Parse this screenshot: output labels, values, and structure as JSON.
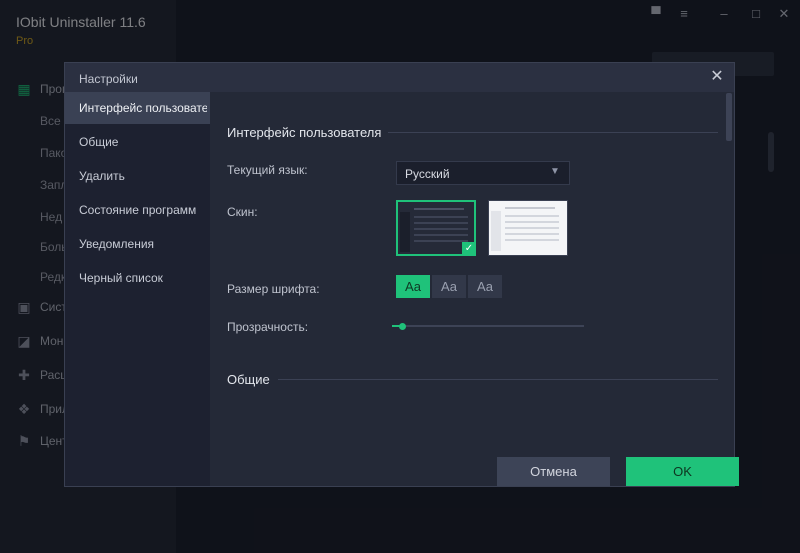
{
  "app": {
    "title": "IObit Uninstaller 11.6",
    "edition": "Pro",
    "nav": [
      {
        "label": "Прог",
        "icon": "grid-icon"
      },
      {
        "label": "Сист",
        "icon": "windows-icon"
      },
      {
        "label": "Мон",
        "icon": "chart-icon"
      },
      {
        "label": "Расш",
        "icon": "puzzle-icon"
      },
      {
        "label": "Прил",
        "icon": "windows-store-icon"
      },
      {
        "label": "Цент",
        "icon": "flag-icon"
      }
    ],
    "subnav": [
      "Все п",
      "Пако",
      "Запл",
      "Нед",
      "Боль",
      "Редк"
    ]
  },
  "dialog": {
    "title": "Настройки",
    "close_icon": "close-icon",
    "nav": [
      {
        "label": "Интерфейс пользовател",
        "active": true
      },
      {
        "label": "Общие",
        "active": false
      },
      {
        "label": "Удалить",
        "active": false
      },
      {
        "label": "Состояние программ",
        "active": false
      },
      {
        "label": "Уведомления",
        "active": false
      },
      {
        "label": "Черный список",
        "active": false
      }
    ],
    "section_ui": "Интерфейс пользователя",
    "language_label": "Текущий язык:",
    "language_value": "Русский",
    "skin_label": "Скин:",
    "font_size_label": "Размер шрифта:",
    "font_sizes": [
      "Aa",
      "Aa",
      "Aa"
    ],
    "font_size_selected": 0,
    "transparency_label": "Прозрачность:",
    "transparency_value": 0.05,
    "section_general": "Общие",
    "cancel_label": "Отмена",
    "ok_label": "OK"
  },
  "colors": {
    "accent": "#1fc27a",
    "background": "#1f2432",
    "dialog_bg": "#242937"
  }
}
